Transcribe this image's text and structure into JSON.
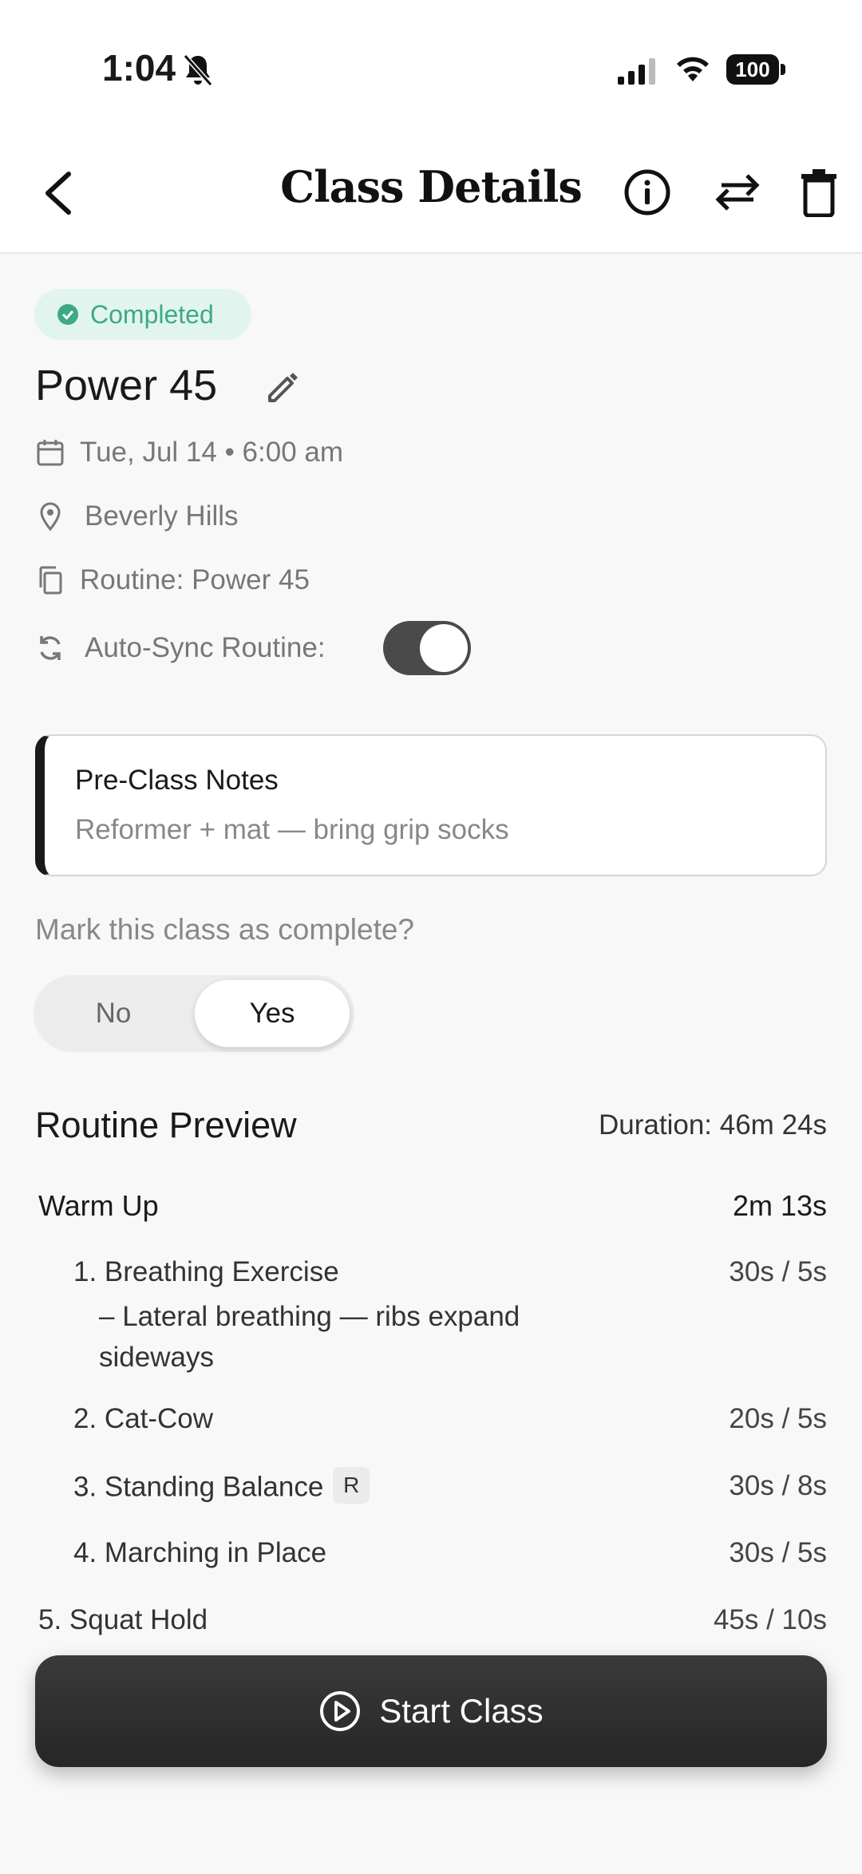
{
  "status_bar": {
    "time": "1:04",
    "battery": "100"
  },
  "header": {
    "title": "Class Details"
  },
  "class": {
    "status": "Completed",
    "title": "Power 45",
    "datetime": "Tue, Jul 14 • 6:00 am",
    "location": "Beverly Hills",
    "routine": "Routine: Power 45",
    "auto_sync_label": "Auto-Sync Routine:",
    "auto_sync_enabled": true
  },
  "notes": {
    "title": "Pre-Class Notes",
    "body": "Reformer + mat — bring grip socks"
  },
  "completion": {
    "question": "Mark this class as complete?",
    "no_label": "No",
    "yes_label": "Yes",
    "selected": "Yes"
  },
  "routine_preview": {
    "heading": "Routine Preview",
    "duration": "Duration: 46m 24s",
    "section": {
      "name": "Warm Up",
      "time": "2m 13s"
    },
    "exercises": [
      {
        "label": "1. Breathing Exercise",
        "time": "30s / 5s",
        "desc_line1": "– Lateral breathing — ribs expand",
        "desc_line2": "sideways"
      },
      {
        "label": "2. Cat-Cow",
        "time": "20s / 5s"
      },
      {
        "label": "3. Standing Balance",
        "time": "30s / 8s",
        "badge": "R"
      },
      {
        "label": "4. Marching in Place",
        "time": "30s / 5s"
      },
      {
        "label": "5. Squat Hold",
        "time": "45s / 10s"
      }
    ]
  },
  "actions": {
    "start_label": "Start Class"
  },
  "colors": {
    "accent_green": "#3daa85",
    "badge_bg": "#e2f4ee",
    "dark": "#2e2e2e"
  }
}
